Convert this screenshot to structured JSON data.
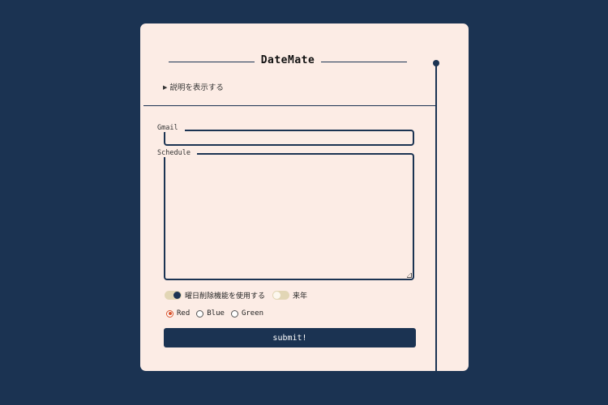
{
  "app": {
    "title": "DateMate",
    "details_toggle": "説明を表示する"
  },
  "form": {
    "gmail_label": "Gmail",
    "gmail_value": "",
    "schedule_label": "Schedule",
    "schedule_value": "",
    "toggles": [
      {
        "label": "曜日削除機能を使用する",
        "on": true
      },
      {
        "label": "来年",
        "on": false
      }
    ],
    "radios": [
      {
        "label": "Red",
        "checked": true
      },
      {
        "label": "Blue",
        "checked": false
      },
      {
        "label": "Green",
        "checked": false
      }
    ],
    "submit_label": "submit!"
  },
  "colors": {
    "background": "#1b3352",
    "card": "#fcece5",
    "accent": "#1b3352",
    "radio_selected": "#d9532c",
    "switch_track": "#e2d6b5"
  }
}
